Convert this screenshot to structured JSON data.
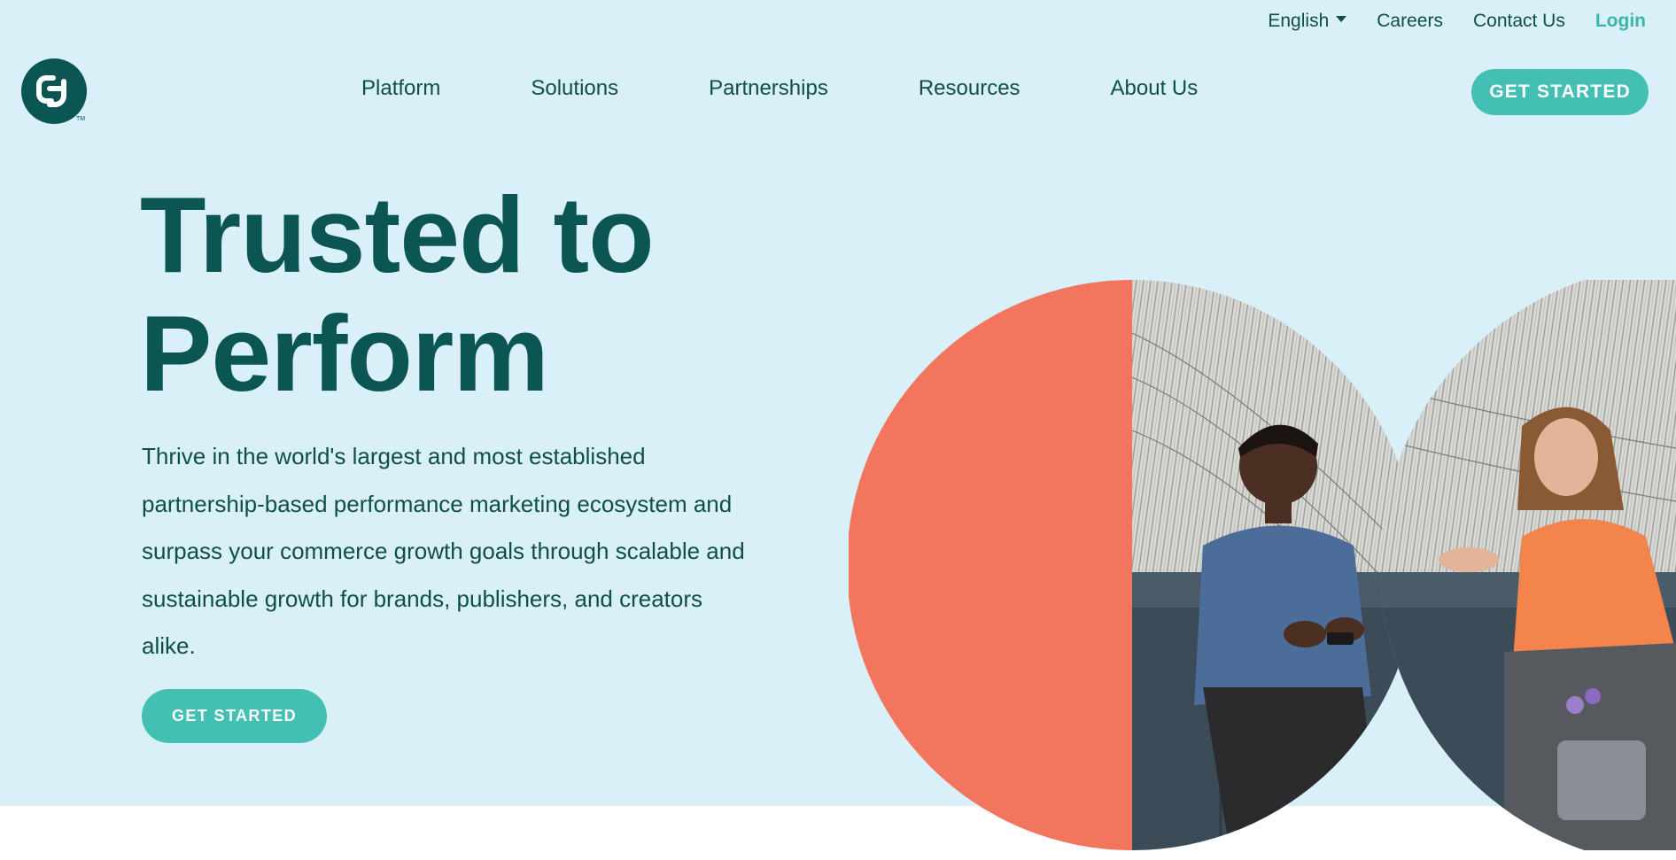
{
  "utility_nav": {
    "language": "English",
    "careers": "Careers",
    "contact": "Contact Us",
    "login": "Login"
  },
  "logo": {
    "alt": "CJ",
    "trademark": "TM"
  },
  "main_nav": {
    "items": [
      "Platform",
      "Solutions",
      "Partnerships",
      "Resources",
      "About Us"
    ]
  },
  "header_cta": "GET STARTED",
  "hero": {
    "headline_line1": "Trusted to",
    "headline_line2": "Perform",
    "body": "Thrive in the world's largest and most established partnership-based performance marketing ecosystem and surpass your commerce growth goals through scalable and sustainable growth for brands, publishers, and creators alike.",
    "cta": "GET STARTED",
    "image": "people-conversation-photo"
  },
  "colors": {
    "background": "#d9f0f8",
    "dark_teal": "#0b5552",
    "accent_teal": "#44bfb3",
    "coral": "#f2765d"
  }
}
